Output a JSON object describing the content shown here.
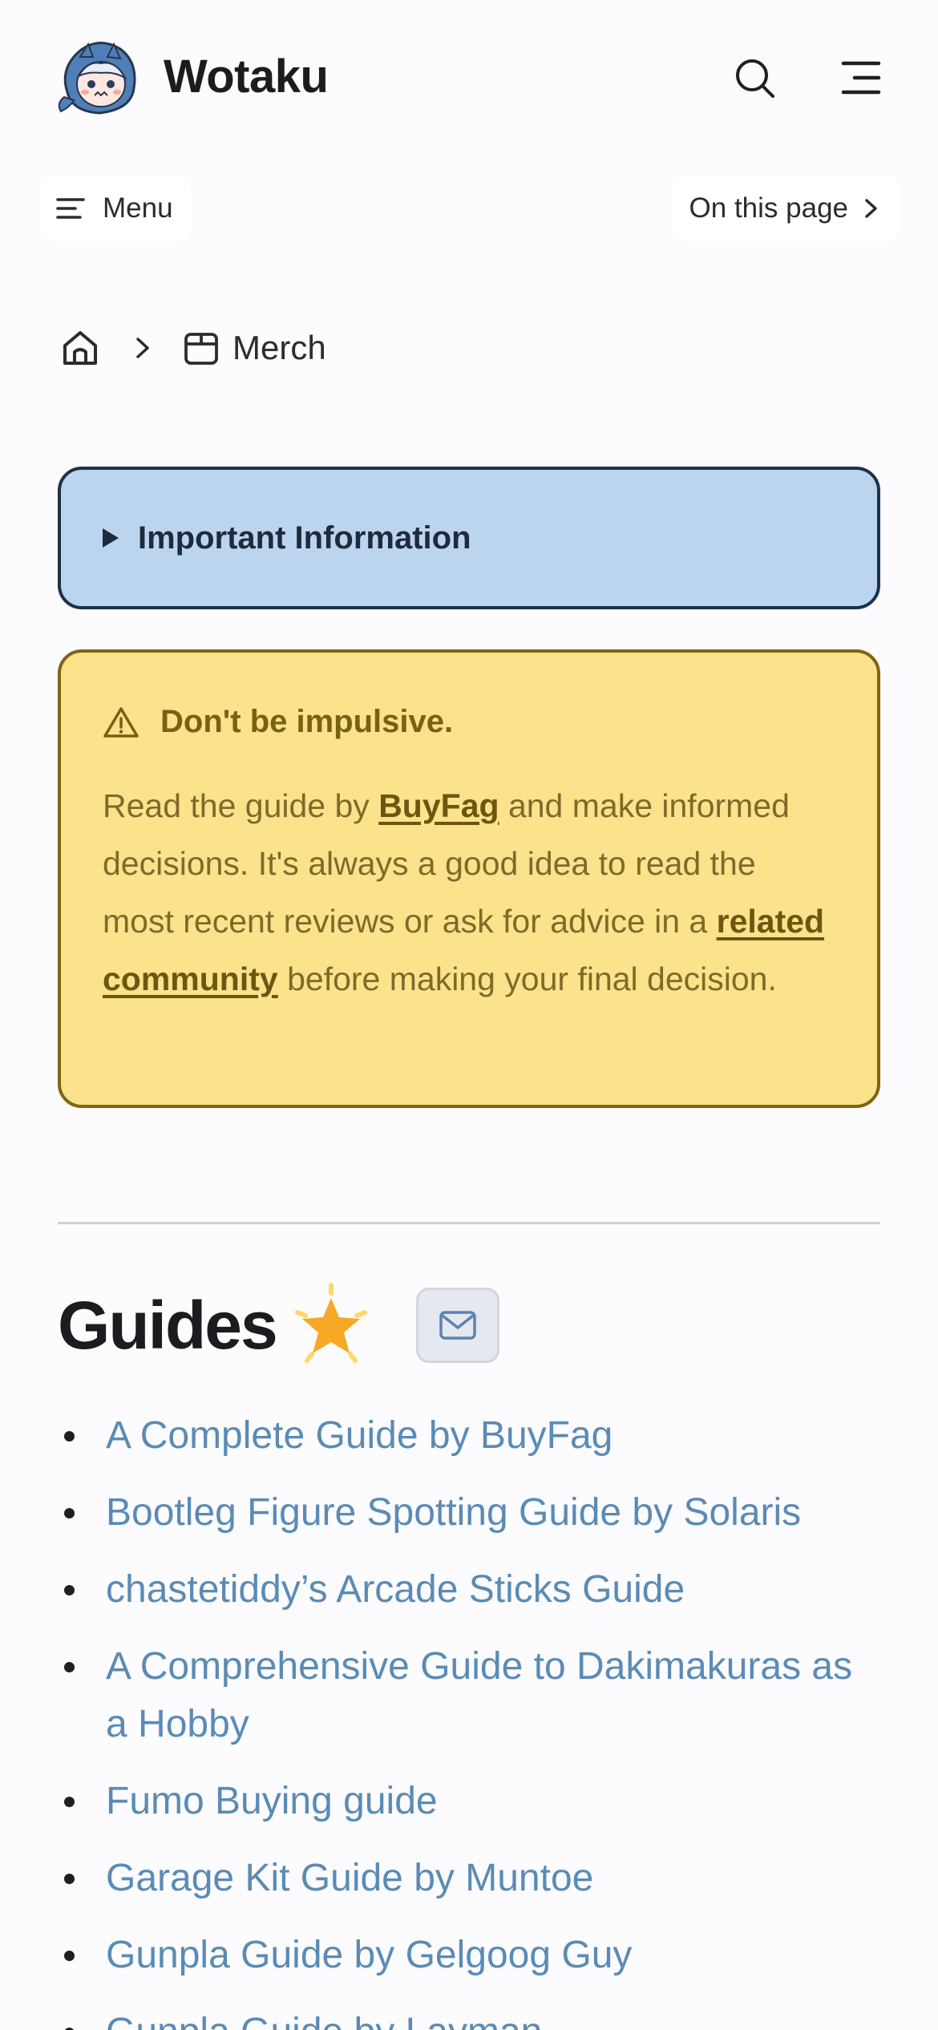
{
  "header": {
    "site_title": "Wotaku",
    "logo_icon": "shark-girl-avatar-icon",
    "search_icon": "search-icon",
    "menu_icon": "hamburger-icon"
  },
  "localnav": {
    "menu_label": "Menu",
    "on_this_page_label": "On this page"
  },
  "breadcrumb": {
    "home_icon": "home-icon",
    "current_label": "Merch",
    "current_icon": "box-icon"
  },
  "info_callout": {
    "label": "Important Information"
  },
  "warning_callout": {
    "title": "Don't be impulsive.",
    "body_part1": "Read the guide by ",
    "link1": "BuyFag",
    "body_part2": " and make informed decisions. It's always a good idea to read the most recent reviews or ask for advice in a ",
    "link2": "related community",
    "body_part3": " before making your final decision."
  },
  "guides": {
    "title": "Guides",
    "title_emoji_icon": "glowing-star-icon",
    "mail_icon": "mail-icon",
    "items": [
      "A Complete Guide by BuyFag",
      "Bootleg Figure Spotting Guide by Solaris",
      "chastetiddy’s Arcade Sticks Guide",
      "A Comprehensive Guide to Dakimakuras as a Hobby",
      "Fumo Buying guide",
      "Garage Kit Guide by Muntoe",
      "Gunpla Guide by Gelgoog Guy",
      "Gunpla Guide by Layman"
    ]
  },
  "colors": {
    "info_bg": "#bcd5ef",
    "warn_bg": "#fbe28b",
    "link": "#5a8bb6"
  }
}
